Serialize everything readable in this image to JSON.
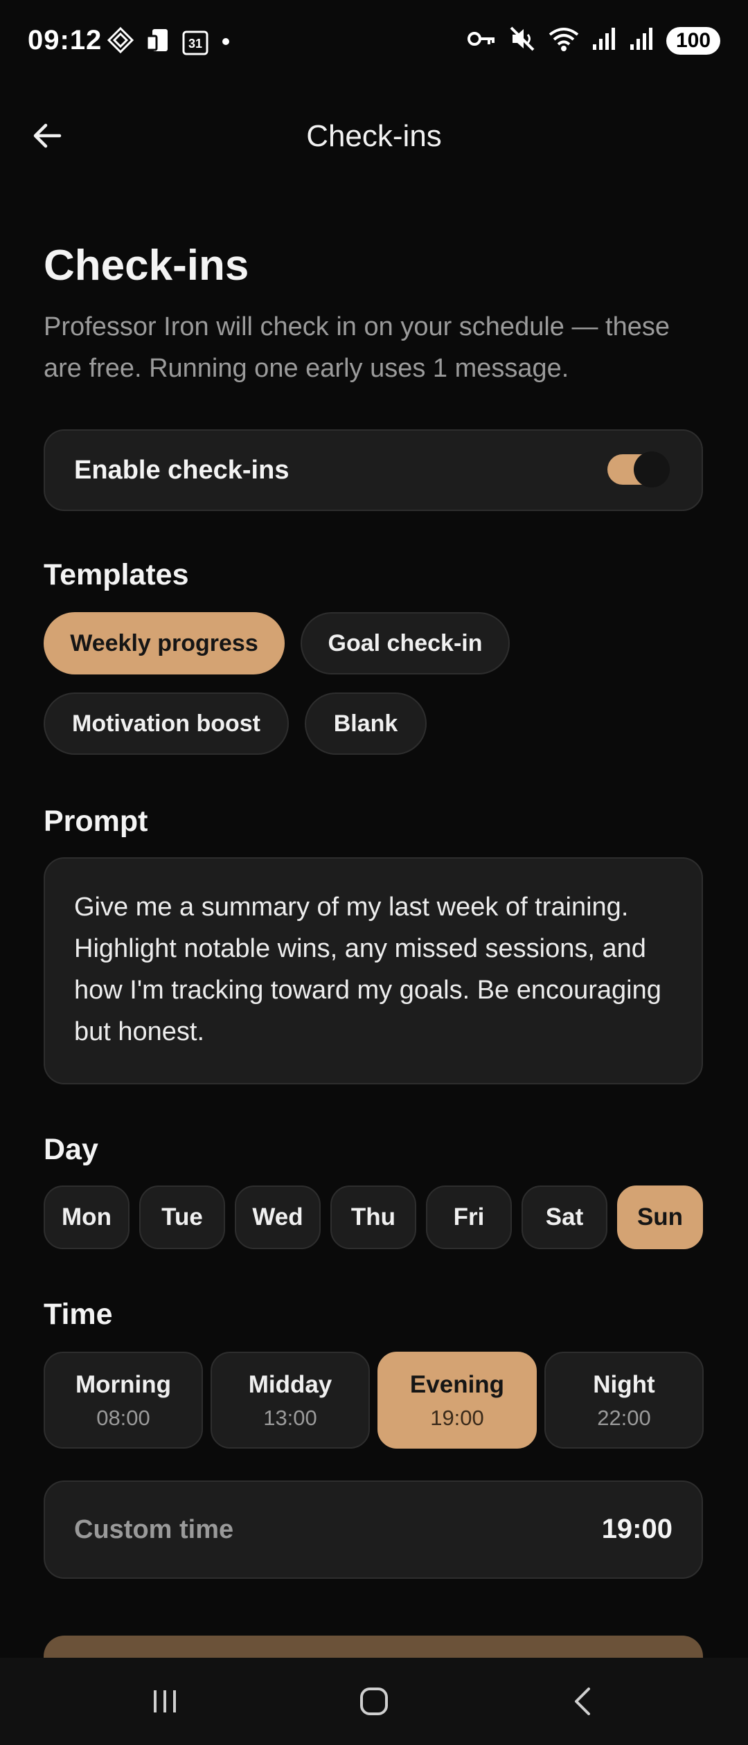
{
  "status_bar": {
    "time": "09:12",
    "calendar_day": "31",
    "battery": "100",
    "left_icons": [
      "diamond-app-icon",
      "phone-device-icon",
      "calendar-icon",
      "dot-icon"
    ],
    "right_icons": [
      "vpn-key-icon",
      "mute-icon",
      "wifi-icon",
      "signal-icon",
      "signal-icon-2"
    ]
  },
  "app_bar": {
    "title": "Check-ins",
    "back_icon": "arrow-left-icon"
  },
  "header": {
    "title": "Check-ins",
    "subtitle": "Professor Iron will check in on your schedule — these are free. Running one early uses 1 message."
  },
  "enable": {
    "label": "Enable check-ins",
    "on": true
  },
  "templates": {
    "label": "Templates",
    "items": [
      {
        "label": "Weekly progress",
        "active": true
      },
      {
        "label": "Goal check-in",
        "active": false
      },
      {
        "label": "Motivation boost",
        "active": false
      },
      {
        "label": "Blank",
        "active": false
      }
    ]
  },
  "prompt": {
    "label": "Prompt",
    "text": "Give me a summary of my last week of training. Highlight notable wins, any missed sessions, and how I'm tracking toward my goals. Be encouraging but honest."
  },
  "day": {
    "label": "Day",
    "items": [
      "Mon",
      "Tue",
      "Wed",
      "Thu",
      "Fri",
      "Sat",
      "Sun"
    ],
    "selected": "Sun"
  },
  "time": {
    "label": "Time",
    "slots": [
      {
        "name": "Morning",
        "time": "08:00"
      },
      {
        "name": "Midday",
        "time": "13:00"
      },
      {
        "name": "Evening",
        "time": "19:00"
      },
      {
        "name": "Night",
        "time": "22:00"
      }
    ],
    "selected": "Evening",
    "custom_label": "Custom time",
    "custom_value": "19:00"
  },
  "colors": {
    "accent": "#d4a373",
    "background": "#0a0a0a",
    "card": "#1d1d1d"
  },
  "nav": {
    "icons": [
      "recents-icon",
      "home-icon",
      "back-nav-icon"
    ]
  }
}
